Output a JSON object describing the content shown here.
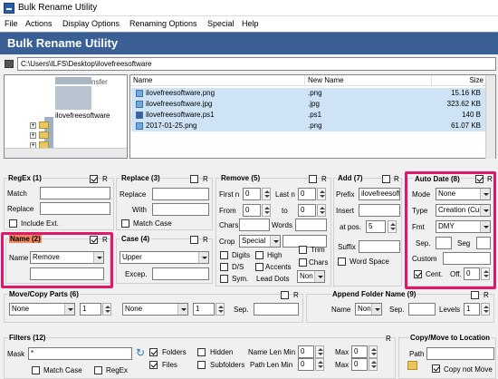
{
  "window": {
    "title": "Bulk Rename Utility"
  },
  "menu": [
    "File",
    "Actions",
    "Display Options",
    "Renaming Options",
    "Special",
    "Help"
  ],
  "banner": {
    "title": "Bulk Rename Utility"
  },
  "path": {
    "value": "C:\\Users\\ILFS\\Desktop\\ilovefreesoftware"
  },
  "tree": {
    "items": [
      "nsfer",
      "ilovefreesoftware"
    ]
  },
  "files": {
    "columns": [
      "Name",
      "New Name",
      "Size"
    ],
    "rows": [
      {
        "name": "ilovefreesoftware.png",
        "ext": ".png",
        "size": "15.16 KB"
      },
      {
        "name": "ilovefreesoftware.jpg",
        "ext": ".jpg",
        "size": "323.62 KB"
      },
      {
        "name": "ilovefreesoftware.ps1",
        "ext": ".ps1",
        "size": "140 B"
      },
      {
        "name": "2017-01-25.png",
        "ext": ".png",
        "size": "61.07 KB"
      }
    ]
  },
  "regex": {
    "title": "RegEx (1)",
    "match": "Match",
    "replace": "Replace",
    "include_ext": "Include Ext.",
    "r": "R"
  },
  "replace": {
    "title": "Replace (3)",
    "replace": "Replace",
    "with": "With",
    "match_case": "Match Case",
    "r": "R"
  },
  "remove": {
    "title": "Remove (5)",
    "first_n": "First n",
    "first_n_val": "0",
    "last_n": "Last n",
    "last_n_val": "0",
    "from": "From",
    "from_val": "0",
    "to": "to",
    "to_val": "0",
    "chars": "Chars",
    "words": "Words",
    "crop": "Crop",
    "crop_val": "Special",
    "digits": "Digits",
    "high": "High",
    "trim": "Trim",
    "ds": "D/S",
    "accents": "Accents",
    "chars2": "Chars",
    "sym": "Sym.",
    "lead_dots": "Lead Dots",
    "lead_val": "Non",
    "r": "R"
  },
  "add": {
    "title": "Add (7)",
    "prefix": "Prefix",
    "prefix_val": "ilovefreesoft",
    "insert": "Insert",
    "at_pos": "at pos.",
    "at_pos_val": "5",
    "suffix": "Suffix",
    "word_space": "Word Space",
    "r": "R"
  },
  "autodate": {
    "title": "Auto Date (8)",
    "mode": "Mode",
    "mode_val": "None",
    "type": "Type",
    "type_val": "Creation (Cur",
    "fmt": "Fmt",
    "fmt_val": "DMY",
    "sep": "Sep.",
    "seg": "Seg",
    "custom": "Custom",
    "cent": "Cent.",
    "off": "Off.",
    "off_val": "0",
    "r": "R"
  },
  "name": {
    "title": "Name (2)",
    "name": "Name",
    "name_val": "Remove",
    "r": "R"
  },
  "case": {
    "title": "Case (4)",
    "case_val": "Upper",
    "excep": "Excep.",
    "r": "R"
  },
  "movecopy": {
    "title": "Move/Copy Parts (6)",
    "sel1": "None",
    "num1": "1",
    "sel2": "None",
    "num2": "1",
    "sep": "Sep.",
    "r": "R"
  },
  "appendfolder": {
    "title": "Append Folder Name (9)",
    "name": "Name",
    "name_val": "None",
    "sep": "Sep.",
    "levels": "Levels",
    "levels_val": "1",
    "r": "R"
  },
  "filters": {
    "title": "Filters (12)",
    "mask": "Mask",
    "mask_val": "*",
    "folders": "Folders",
    "hidden": "Hidden",
    "files": "Files",
    "subfolders": "Subfolders",
    "name_len_min": "Name Len Min",
    "path_len_min": "Path Len Min",
    "nlm_val": "0",
    "plm_val": "0",
    "max": "Max",
    "max1_val": "0",
    "max2_val": "0",
    "match_case": "Match Case",
    "regex": "RegEx",
    "r": "R"
  },
  "copymove": {
    "title": "Copy/Move to Location",
    "path": "Path",
    "copy_not_move": "Copy not Move"
  },
  "colors": {
    "banner": "#3a5f94",
    "highlight": "#e0186a",
    "selection": "#cfe3f7"
  }
}
